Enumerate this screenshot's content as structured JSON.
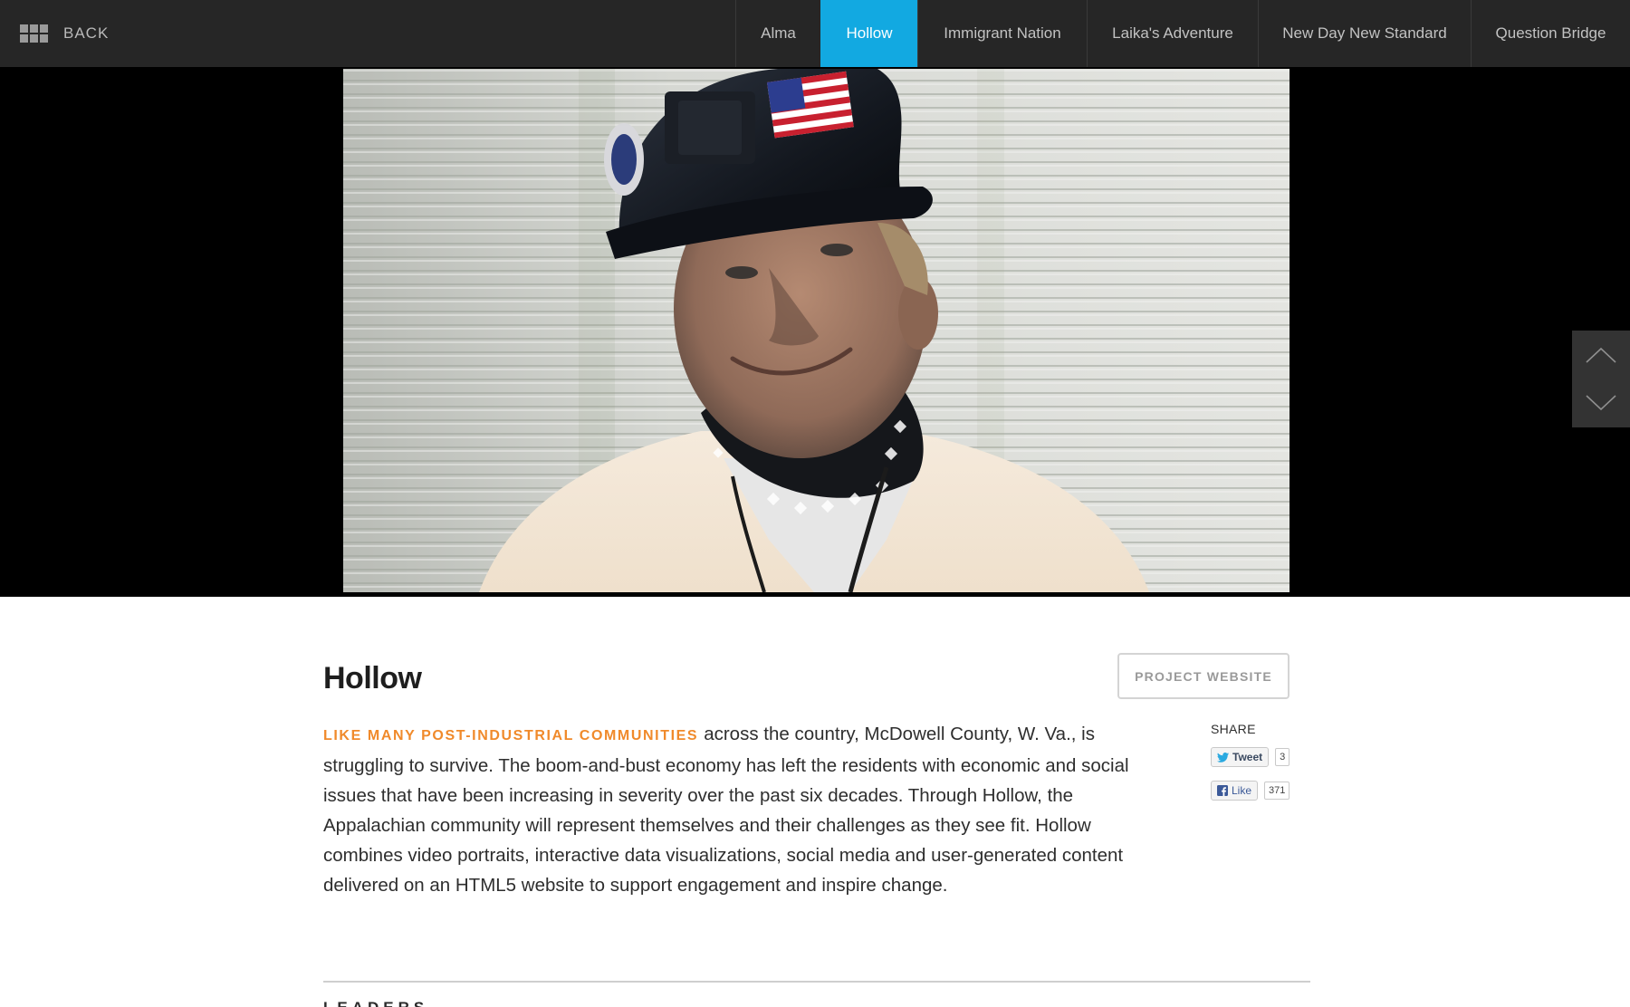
{
  "topbar": {
    "back_label": "BACK",
    "tabs": [
      {
        "label": "Alma",
        "active": false
      },
      {
        "label": "Hollow",
        "active": true
      },
      {
        "label": "Immigrant Nation",
        "active": false
      },
      {
        "label": "Laika's Adventure",
        "active": false
      },
      {
        "label": "New Day New Standard",
        "active": false
      },
      {
        "label": "Question Bridge",
        "active": false
      }
    ],
    "active_color": "#12a9e1"
  },
  "hero": {
    "icons": [
      "arrow-up-icon",
      "arrow-down-icon"
    ]
  },
  "project": {
    "title": "Hollow",
    "website_button": "PROJECT WEBSITE",
    "lead_in": "LIKE MANY POST-INDUSTRIAL COMMUNITIES",
    "description": "across the country, McDowell County, W. Va., is struggling to survive. The boom-and-bust economy has left the residents with economic and social issues that have been increasing in severity over the past six decades. Through Hollow, the Appalachian community will represent themselves and their challenges as they see fit. Hollow combines video portraits, interactive data visualizations, social media and user-generated content delivered on an HTML5 website to support engagement and inspire change.",
    "lead_color": "#f08a2b"
  },
  "share": {
    "label": "SHARE",
    "tweet_label": "Tweet",
    "tweet_count": "3",
    "like_label": "Like",
    "like_count": "371"
  },
  "leaders": {
    "heading": "LEADERS"
  }
}
